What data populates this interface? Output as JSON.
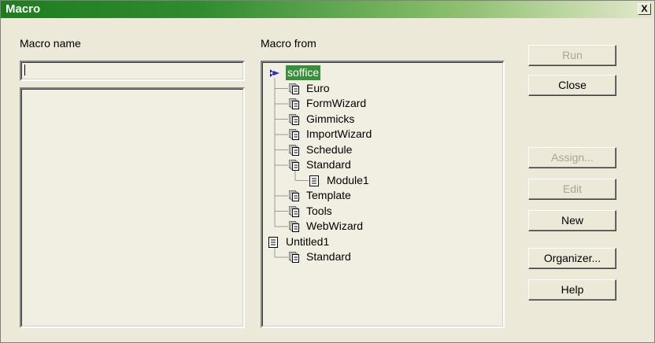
{
  "window": {
    "title": "Macro",
    "close_glyph": "X"
  },
  "macro_name": {
    "label": "Macro name",
    "value": ""
  },
  "macro_from": {
    "label": "Macro from"
  },
  "tree": [
    {
      "label": "soffice",
      "icon": "application-icon",
      "level": 0,
      "selected": true
    },
    {
      "label": "Euro",
      "icon": "library-icon",
      "level": 1
    },
    {
      "label": "FormWizard",
      "icon": "library-icon",
      "level": 1
    },
    {
      "label": "Gimmicks",
      "icon": "library-icon",
      "level": 1
    },
    {
      "label": "ImportWizard",
      "icon": "library-icon",
      "level": 1
    },
    {
      "label": "Schedule",
      "icon": "library-icon",
      "level": 1
    },
    {
      "label": "Standard",
      "icon": "library-icon",
      "level": 1,
      "expanded": true
    },
    {
      "label": "Module1",
      "icon": "module-icon",
      "level": 2
    },
    {
      "label": "Template",
      "icon": "library-icon",
      "level": 1
    },
    {
      "label": "Tools",
      "icon": "library-icon",
      "level": 1
    },
    {
      "label": "WebWizard",
      "icon": "library-icon",
      "level": 1
    },
    {
      "label": "Untitled1",
      "icon": "document-icon",
      "level": 0
    },
    {
      "label": "Standard",
      "icon": "library-icon",
      "level": 1,
      "expanded": true
    }
  ],
  "buttons": {
    "run": "Run",
    "close": "Close",
    "assign": "Assign...",
    "edit": "Edit",
    "new": "New",
    "organizer": "Organizer...",
    "help": "Help"
  },
  "colors": {
    "title_start": "#1E7E1E",
    "selection": "#3A8F3A",
    "face": "#ECE9D8"
  }
}
